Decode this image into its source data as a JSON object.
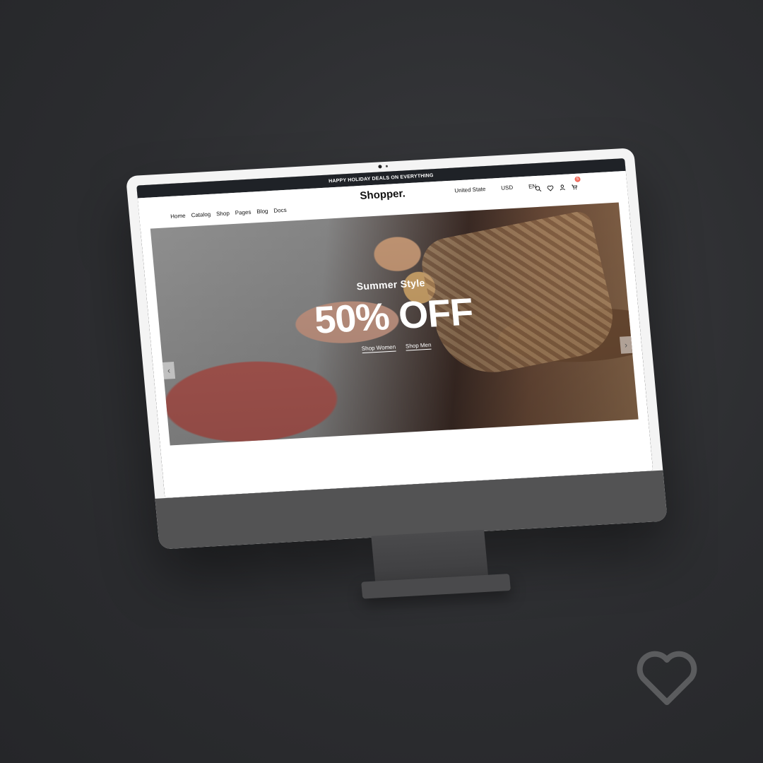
{
  "promo": {
    "text": "HAPPY HOLIDAY DEALS ON EVERYTHING"
  },
  "brand": {
    "logo": "Shopper."
  },
  "nav": {
    "menu": [
      "Home",
      "Catalog",
      "Shop",
      "Pages",
      "Blog",
      "Docs"
    ],
    "locale": {
      "country": "United State",
      "currency": "USD",
      "language": "EN"
    },
    "cart_count": "5"
  },
  "hero": {
    "kicker": "Summer Style",
    "headline": "50% OFF",
    "links": [
      "Shop Women",
      "Shop Men"
    ]
  },
  "colors": {
    "background": "#2c2d30",
    "monitor_bezel": "#f4f4f4",
    "monitor_chin": "#535354",
    "promo_bar": "#1f2227",
    "accent": "#f06b5d"
  }
}
